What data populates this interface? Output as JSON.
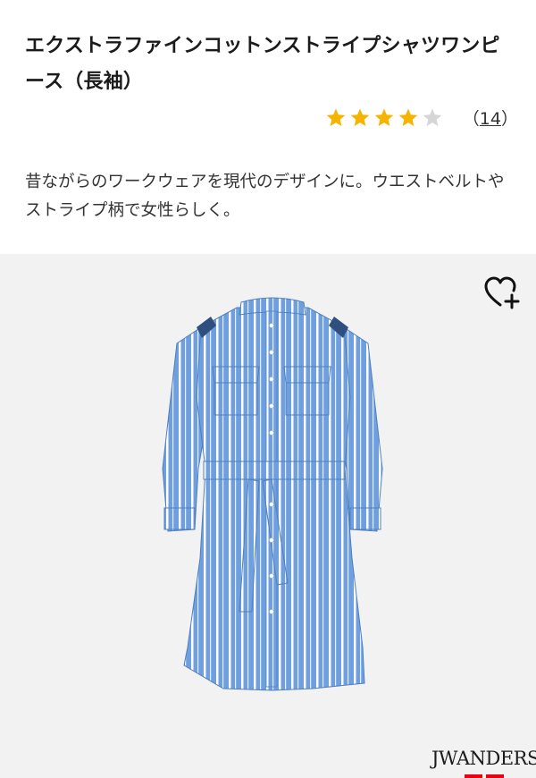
{
  "product": {
    "title": "エクストラファインコットンストライプシャツワンピース（長袖）",
    "description": "昔ながらのワークウェアを現代のデザインに。ウエストベルトやストライプ柄で女性らしく。"
  },
  "rating": {
    "value": 4,
    "max": 5,
    "review_count_open": "（",
    "review_count": "14",
    "review_count_close": "）"
  },
  "image": {
    "favorite_icon": "heart-plus-icon",
    "brand_logo": "JWANDERSON"
  },
  "colors": {
    "star_filled": "#f5b400",
    "star_empty": "#d6d6d6",
    "shirt_blue": "#6f9fdc",
    "stripe": "#ffffff",
    "background": "#f2f2f2",
    "brand_red": "#e60012"
  }
}
